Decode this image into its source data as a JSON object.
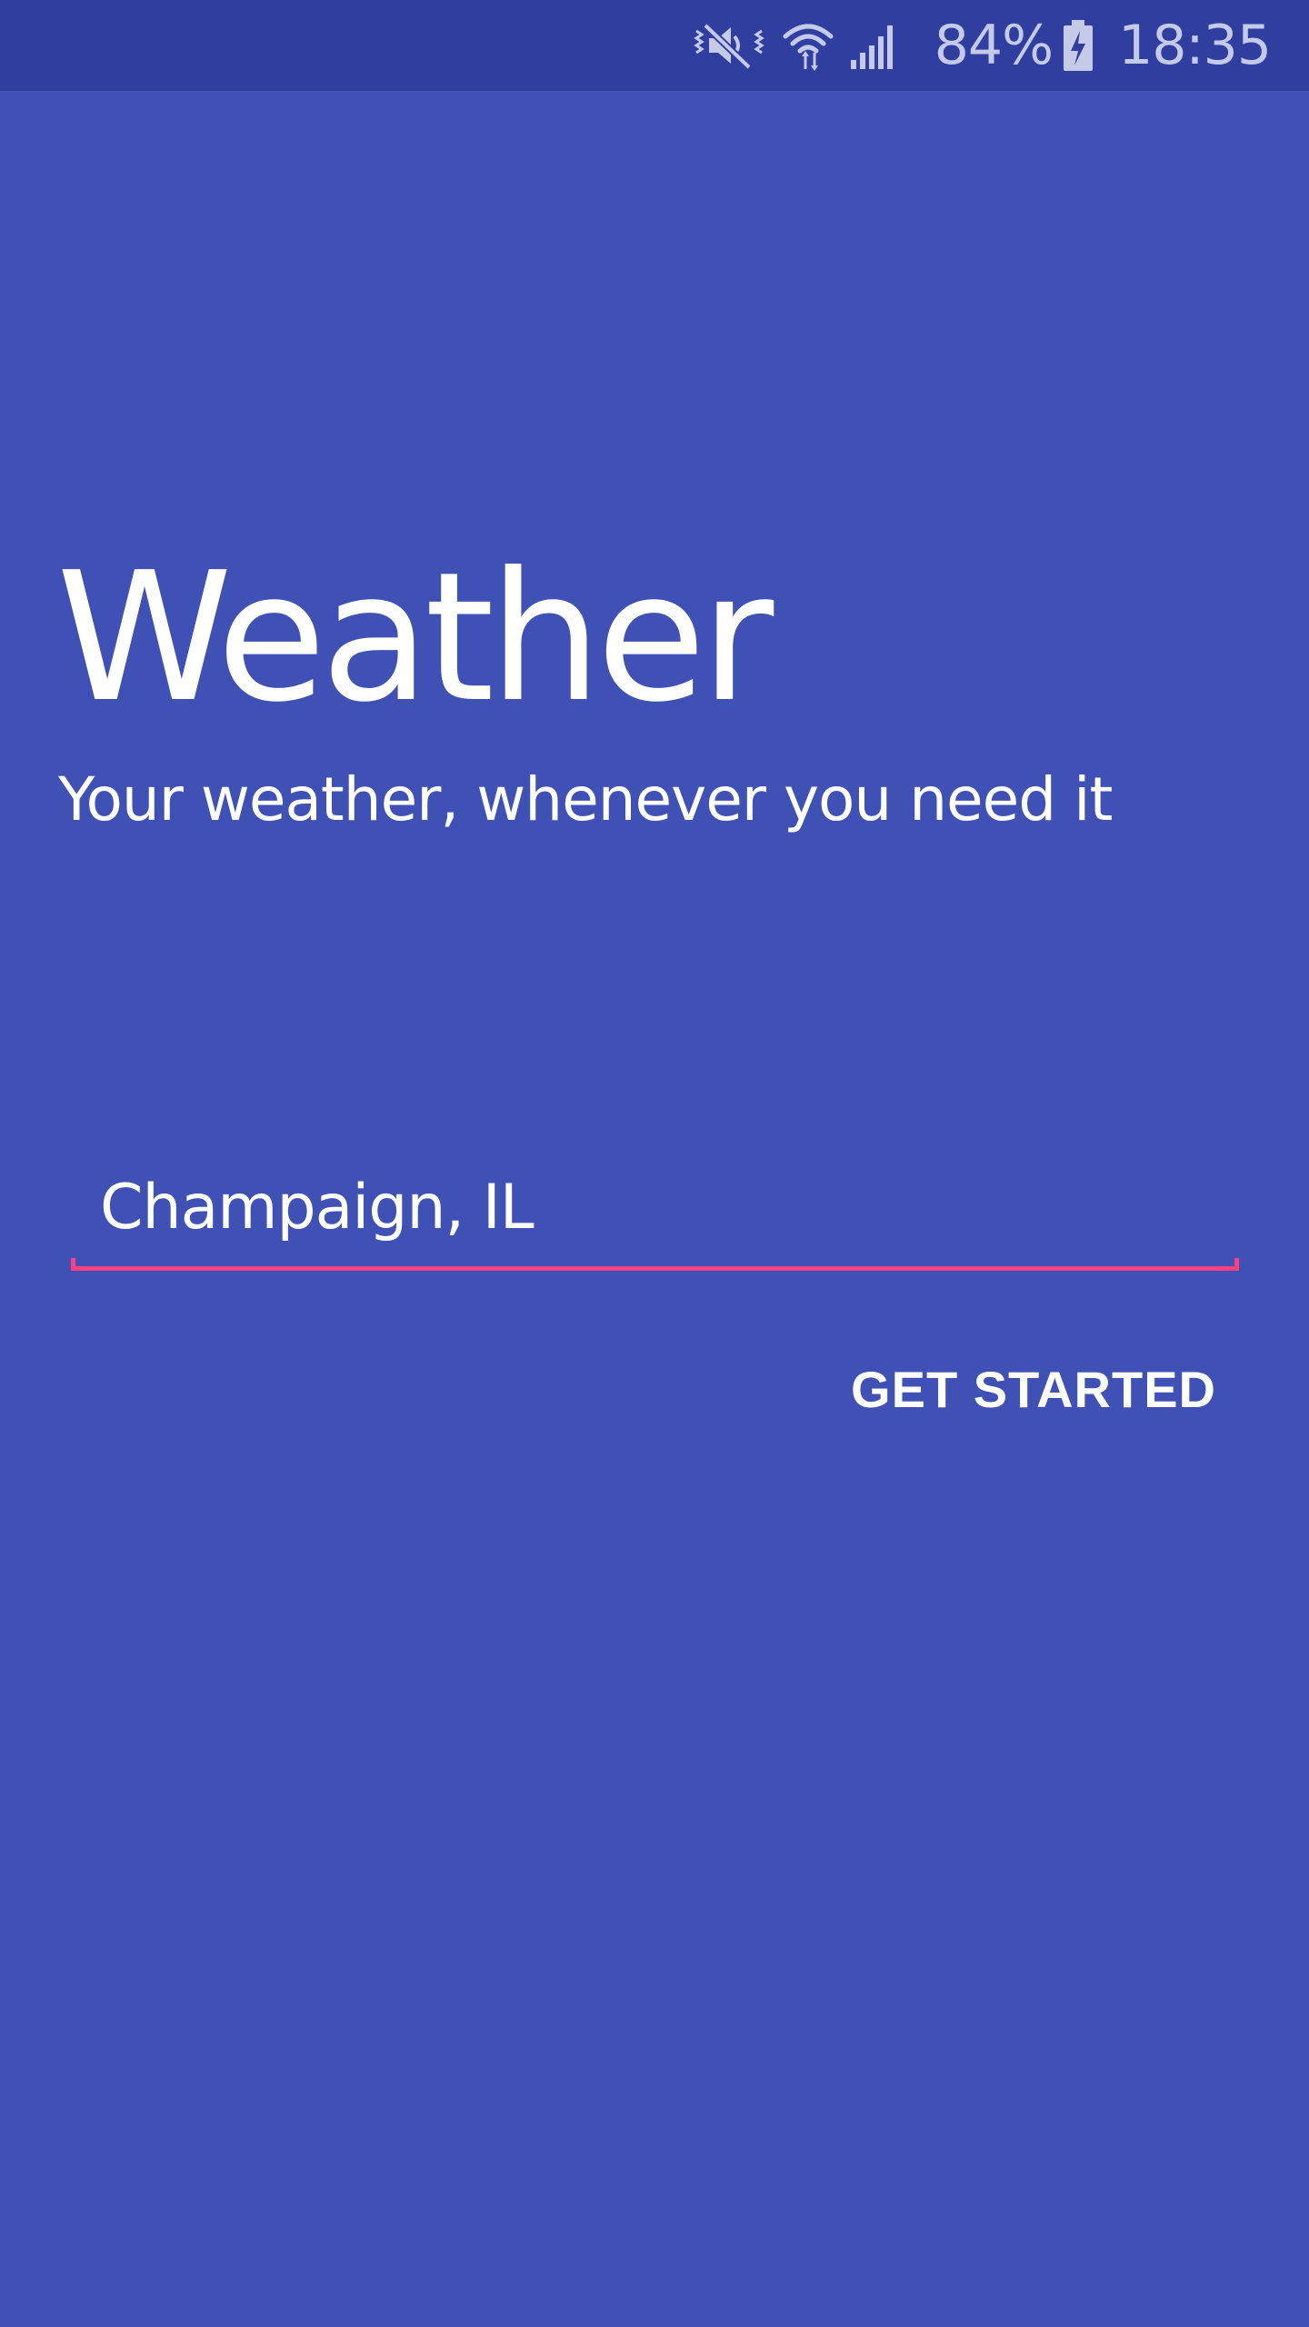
{
  "status_bar": {
    "battery_percent": "84%",
    "time": "18:35",
    "icons": [
      "mute-vibrate-icon",
      "wifi-icon",
      "signal-icon",
      "battery-charging-icon"
    ]
  },
  "app": {
    "title": "Weather",
    "tagline": "Your weather, whenever you need it"
  },
  "location_input": {
    "value": "Champaign, IL",
    "accent_color": "#FF4081"
  },
  "actions": {
    "get_started_label": "GET STARTED"
  },
  "colors": {
    "primary": "#3F51B5",
    "primary_dark": "#303F9F",
    "accent": "#FF4081"
  }
}
